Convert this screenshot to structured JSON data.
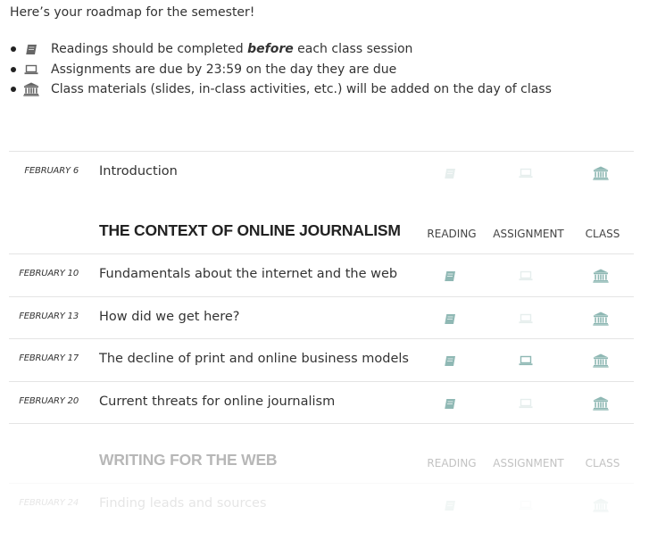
{
  "intro": "Here’s your roadmap for the semester!",
  "legend": [
    {
      "icon": "book-icon",
      "pre": "Readings should be completed ",
      "em": "before",
      "post": " each class session"
    },
    {
      "icon": "laptop-icon",
      "pre": "Assignments are due by 23:59 on the day they are due",
      "em": "",
      "post": ""
    },
    {
      "icon": "museum-icon",
      "pre": "Class materials (slides, in-class activities, etc.) will be added on the day of class",
      "em": "",
      "post": ""
    }
  ],
  "columns": {
    "reading": "READING",
    "assignment": "ASSIGNMENT",
    "class": "CLASS"
  },
  "colors": {
    "active": "#8fb8b4",
    "inactive": "#e6eeed",
    "legend_icon": "#666666"
  },
  "intro_row": {
    "date": "FEBRUARY 6",
    "title": "Introduction",
    "reading": false,
    "assignment": false,
    "class": true
  },
  "sections": [
    {
      "title": "THE CONTEXT OF ONLINE JOURNALISM",
      "rows": [
        {
          "date": "FEBRUARY 10",
          "title": "Fundamentals about the internet and the web",
          "reading": true,
          "assignment": false,
          "class": true
        },
        {
          "date": "FEBRUARY 13",
          "title": "How did we get here?",
          "reading": true,
          "assignment": false,
          "class": true
        },
        {
          "date": "FEBRUARY 17",
          "title": "The decline of print and online business models",
          "reading": true,
          "assignment": true,
          "class": true
        },
        {
          "date": "FEBRUARY 20",
          "title": "Current threats for online journalism",
          "reading": true,
          "assignment": false,
          "class": true
        }
      ]
    },
    {
      "title": "WRITING FOR THE WEB",
      "rows": [
        {
          "date": "FEBRUARY 24",
          "title": "Finding leads and sources",
          "reading": true,
          "assignment": false,
          "class": true
        }
      ]
    }
  ]
}
